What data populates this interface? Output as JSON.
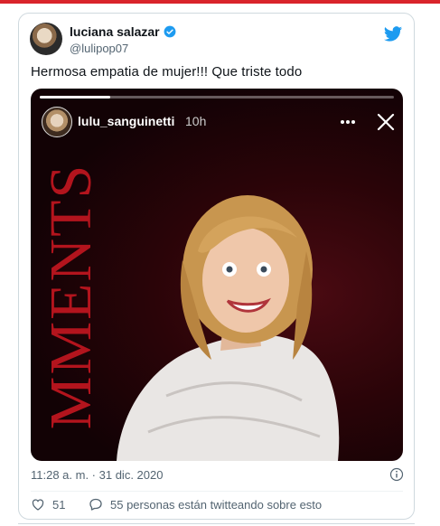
{
  "tweet": {
    "display_name": "luciana salazar",
    "handle": "@lulipop07",
    "text": "Hermosa empatia de mujer!!! Que triste todo",
    "timestamp": "11:28 a. m. · 31 dic. 2020",
    "likes": "51",
    "conversation": "55 personas están twitteando sobre esto"
  },
  "story": {
    "username": "lulu_sanguinetti",
    "time": "10h",
    "progress": 0.2,
    "poster_text": "MMENTS"
  },
  "icons": {
    "verified": "verified-badge-icon",
    "brand": "twitter-bird-icon",
    "more": "more-dots-icon",
    "close": "close-icon",
    "info": "info-icon",
    "like": "heart-icon",
    "reply": "chat-bubble-icon"
  },
  "colors": {
    "accent": "#1d9bf0",
    "text": "#0f1419",
    "muted": "#536471",
    "poster_red": "#b3141d",
    "top_bar": "#d9242b"
  }
}
